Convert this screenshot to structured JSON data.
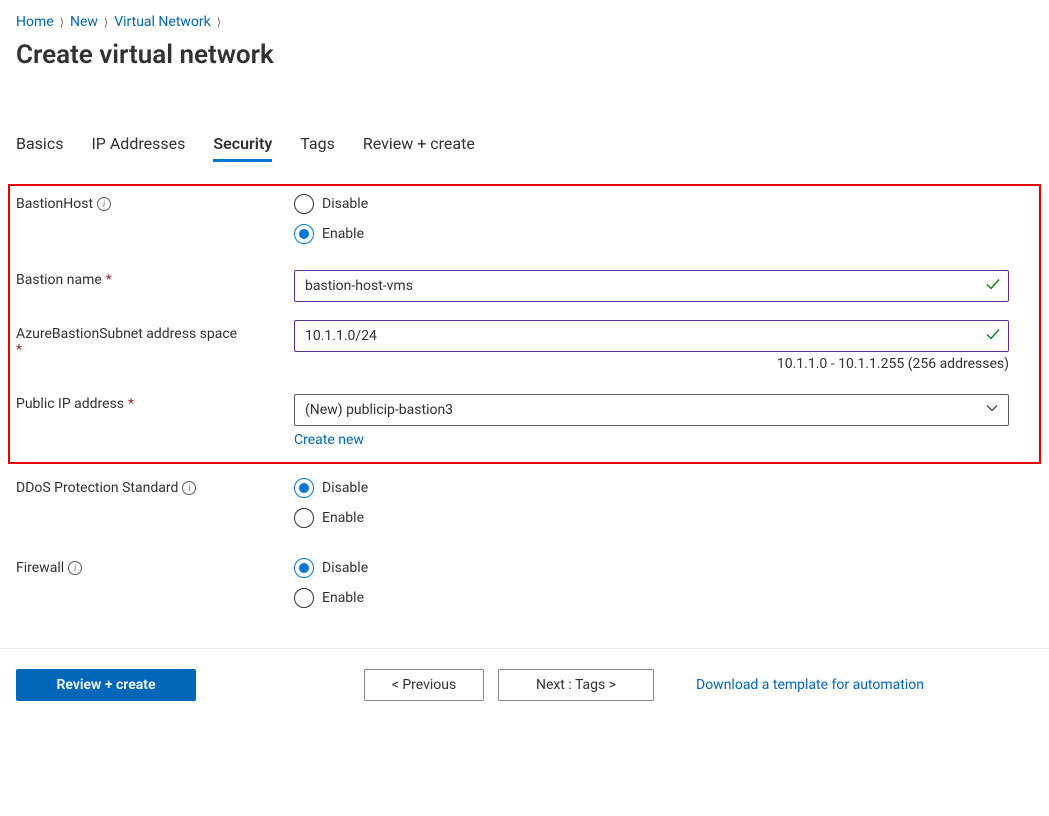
{
  "breadcrumbs": [
    "Home",
    "New",
    "Virtual Network"
  ],
  "page_title": "Create virtual network",
  "tabs": [
    "Basics",
    "IP Addresses",
    "Security",
    "Tags",
    "Review + create"
  ],
  "active_tab_index": 2,
  "security": {
    "bastion_host": {
      "label": "BastionHost",
      "options": {
        "disable": "Disable",
        "enable": "Enable"
      },
      "selected": "enable"
    },
    "bastion_name": {
      "label": "Bastion name",
      "value": "bastion-host-vms"
    },
    "bastion_subnet": {
      "label": "AzureBastionSubnet address space",
      "value": "10.1.1.0/24",
      "helper": "10.1.1.0 - 10.1.1.255 (256 addresses)"
    },
    "public_ip": {
      "label": "Public IP address",
      "selected": "(New) publicip-bastion3",
      "create_new_label": "Create new"
    },
    "ddos": {
      "label": "DDoS Protection Standard",
      "options": {
        "disable": "Disable",
        "enable": "Enable"
      },
      "selected": "disable"
    },
    "firewall": {
      "label": "Firewall",
      "options": {
        "disable": "Disable",
        "enable": "Enable"
      },
      "selected": "disable"
    }
  },
  "footer": {
    "review_create": "Review + create",
    "previous": "< Previous",
    "next": "Next : Tags >",
    "download_template": "Download a template for automation"
  }
}
